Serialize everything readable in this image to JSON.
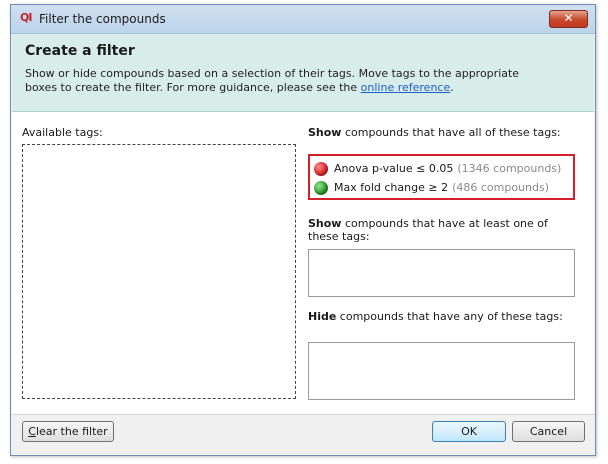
{
  "window": {
    "logo_text": "QI",
    "title": "Filter the compounds",
    "close_glyph": "✕"
  },
  "header": {
    "title": "Create a filter",
    "desc_line1": "Show or hide compounds based on a selection of their tags. Move tags to the appropriate",
    "desc_line2_prefix": "boxes to create the filter. For more guidance, please see the ",
    "desc_link": "online reference",
    "desc_line2_suffix": "."
  },
  "available": {
    "label": "Available tags:"
  },
  "show_all": {
    "label_bold": "Show",
    "label_rest": " compounds that have all of these tags:",
    "tags": [
      {
        "name": "Anova p-value ≤ 0.05",
        "count": "(1346 compounds)",
        "color": "#e0242b"
      },
      {
        "name": "Max fold change ≥ 2",
        "count": "(486 compounds)",
        "color": "#2f9c2f"
      }
    ]
  },
  "show_any": {
    "label_bold": "Show",
    "label_rest": " compounds that have at least one of these tags:"
  },
  "hide_any": {
    "label_bold": "Hide",
    "label_rest": " compounds that have any of these tags:"
  },
  "buttons": {
    "clear_underline": "C",
    "clear_rest": "lear the filter",
    "ok": "OK",
    "cancel": "Cancel"
  },
  "colors": {
    "header_bg": "#d8ede9",
    "highlight_border": "#d4202a",
    "link": "#1a5fc4"
  }
}
